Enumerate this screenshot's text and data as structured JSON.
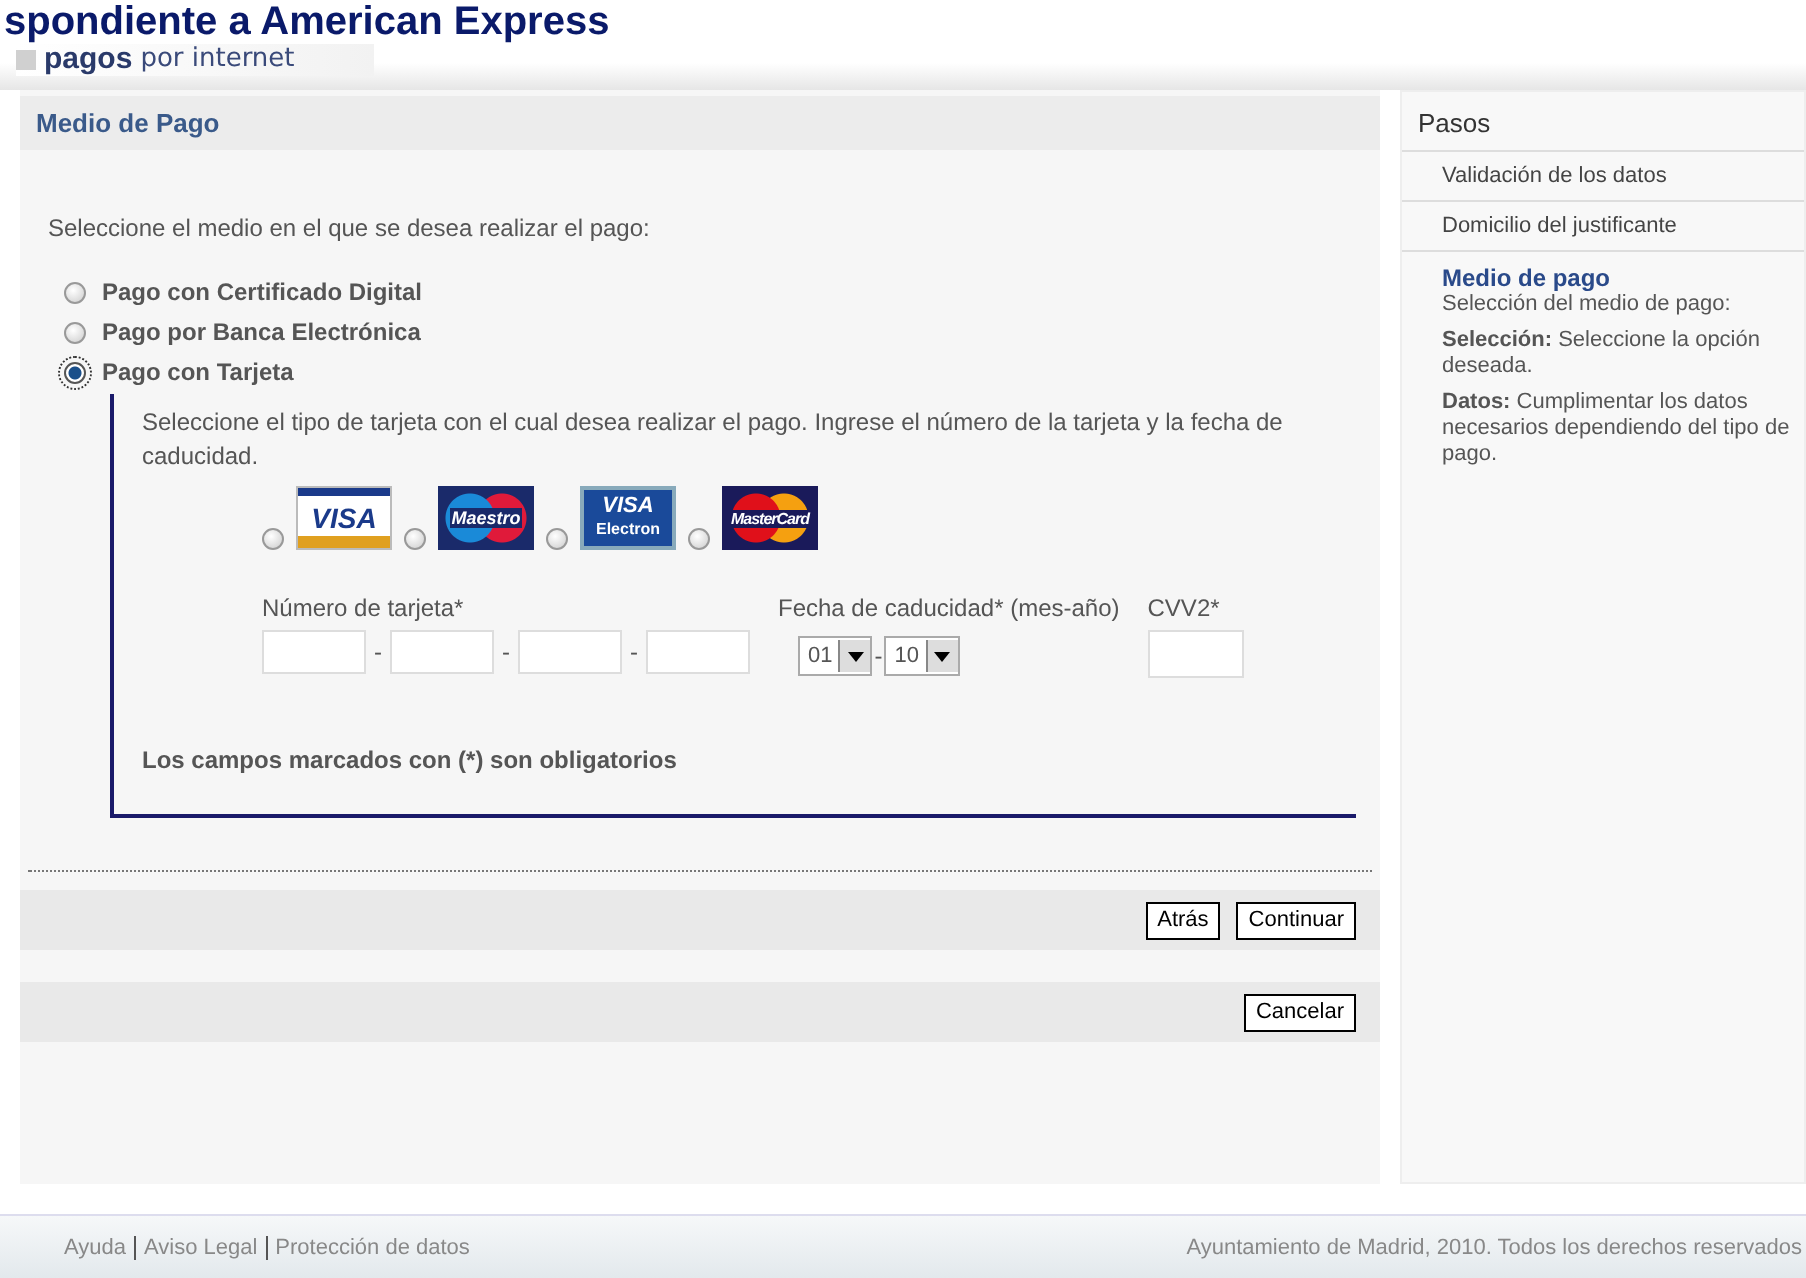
{
  "page_heading": "spondiente a American Express",
  "logo": {
    "brand": "pagos",
    "tagline": "por internet"
  },
  "panel": {
    "title": "Medio de Pago",
    "prompt": "Seleccione el medio en el que se desea realizar el pago:",
    "methods": [
      {
        "label": "Pago con Certificado Digital",
        "selected": false
      },
      {
        "label": "Pago por Banca Electrónica",
        "selected": false
      },
      {
        "label": "Pago con Tarjeta",
        "selected": true
      }
    ],
    "card_section": {
      "instructions": "Seleccione el tipo de tarjeta con el cual desea realizar el pago. Ingrese el número de la tarjeta y la fecha de caducidad.",
      "card_types": [
        {
          "kind": "visa",
          "label": "VISA",
          "selected": false
        },
        {
          "kind": "maestro",
          "label": "Maestro",
          "selected": false
        },
        {
          "kind": "electron",
          "label": "VISA",
          "sublabel": "Electron",
          "selected": false
        },
        {
          "kind": "mastercard",
          "label": "MasterCard",
          "selected": false
        }
      ],
      "card_number_label": "Número de tarjeta*",
      "number_separators": [
        "-",
        "-",
        "-"
      ],
      "expiry_label": "Fecha de caducidad* (mes-año)",
      "expiry_month": "01",
      "expiry_separator": "-",
      "expiry_year": "10",
      "cvv_label": "CVV2*",
      "required_note": "Los campos marcados con (*) son obligatorios"
    },
    "buttons": [
      "Atrás",
      "Continuar"
    ],
    "cancel_button": "Cancelar"
  },
  "steps": {
    "title": "Pasos",
    "items": [
      {
        "label": "Validación de los datos",
        "current": false
      },
      {
        "label": "Domicilio del justificante",
        "current": false
      },
      {
        "label": "Medio de pago",
        "current": true,
        "details": [
          "Selección del medio de pago:",
          "**Selección:** Seleccione la opción deseada.",
          "**Datos:** Cumplimentar los datos necesarios dependiendo del tipo de pago."
        ]
      }
    ]
  },
  "footer": {
    "links": [
      "Ayuda",
      "Aviso Legal",
      "Protección de datos"
    ],
    "copyright": "Ayuntamiento de Madrid, 2010. Todos los derechos reservados"
  }
}
